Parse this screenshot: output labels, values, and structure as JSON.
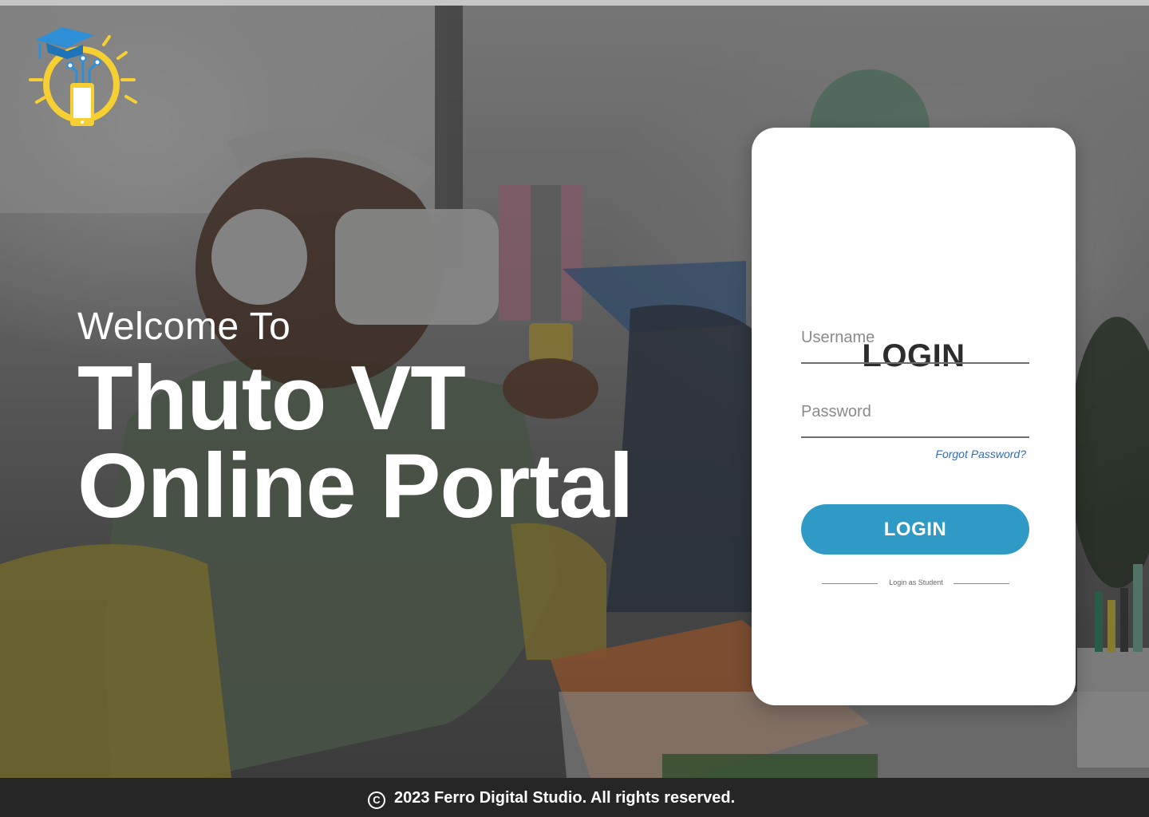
{
  "welcome": {
    "line1": "Welcome To",
    "headline": "Thuto VT\nOnline Portal"
  },
  "login": {
    "title": "LOGIN",
    "username_placeholder": "Username",
    "password_placeholder": "Password",
    "forgot_password": "Forgot Password?",
    "button_label": "LOGIN",
    "student_link": "Login as Student"
  },
  "footer": {
    "copyright_icon": "copyright-icon",
    "text": "2023 Ferro Digital Studio. All rights reserved."
  },
  "colors": {
    "accent": "#2f9ac6",
    "link": "#2b6cc4",
    "logo_yellow": "#f6d033",
    "logo_blue": "#2f8fd6",
    "footer_bg": "#262626"
  },
  "icons": {
    "logo": "lightbulb-graduation-cap-logo"
  }
}
